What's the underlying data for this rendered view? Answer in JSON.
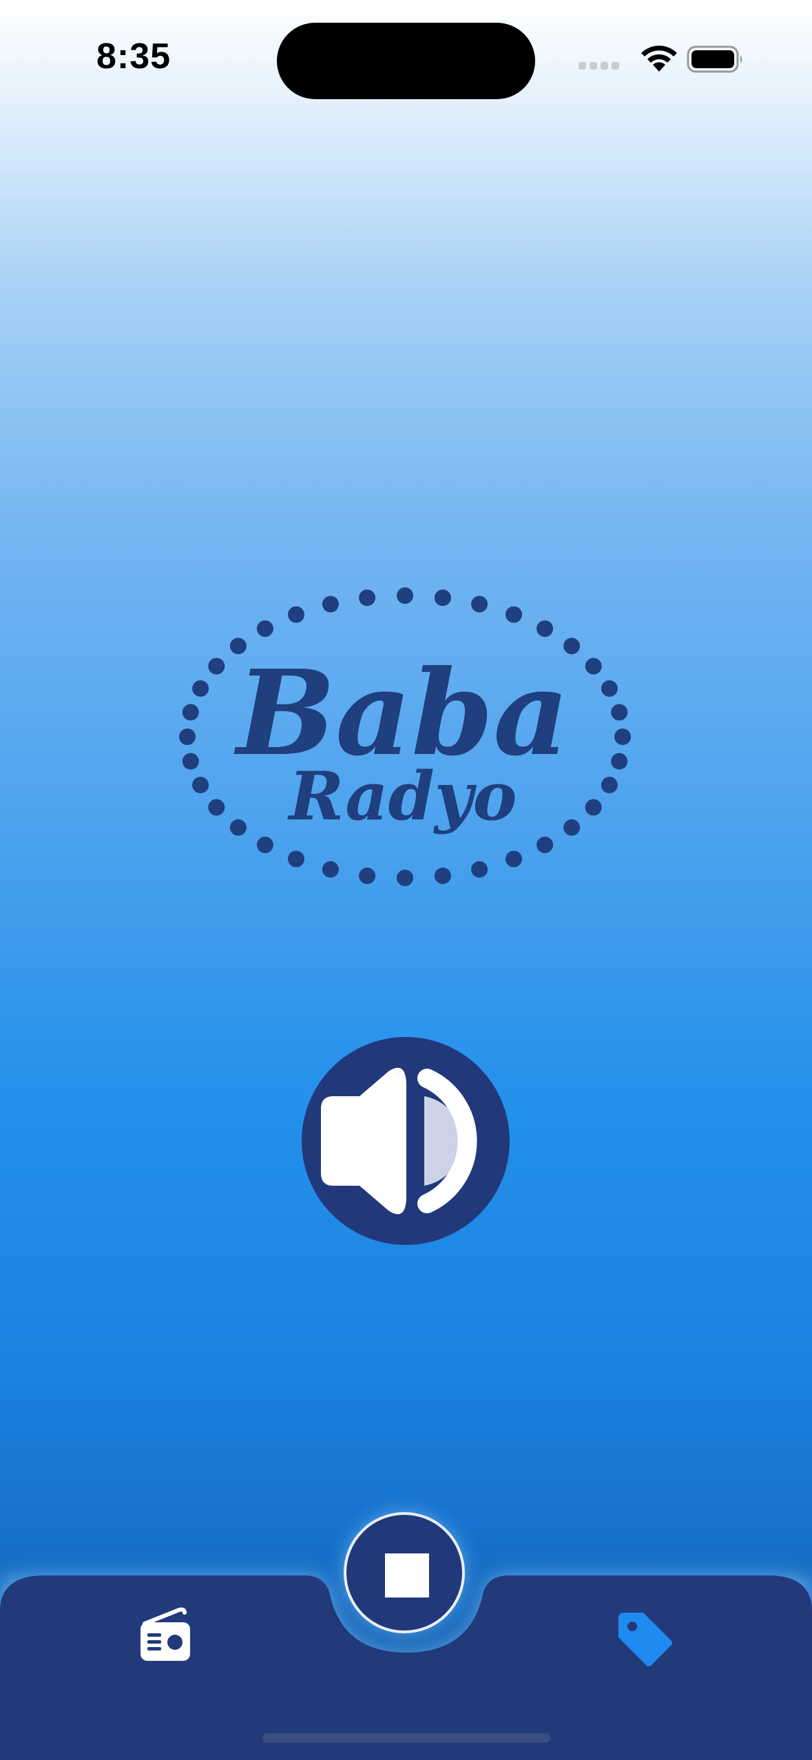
{
  "status_bar": {
    "time": "8:35"
  },
  "logo": {
    "line1": "Baba",
    "line2": "Radyo",
    "color": "#1f3f7e"
  },
  "player": {
    "volume_icon": "speaker-volume-icon",
    "stop_icon": "stop-icon"
  },
  "tab_bar": {
    "items": [
      {
        "icon": "radio-icon",
        "active": false
      },
      {
        "icon": "tag-icon",
        "active": true
      }
    ],
    "bg_color": "#223a7a",
    "active_color": "#1f8af0"
  }
}
